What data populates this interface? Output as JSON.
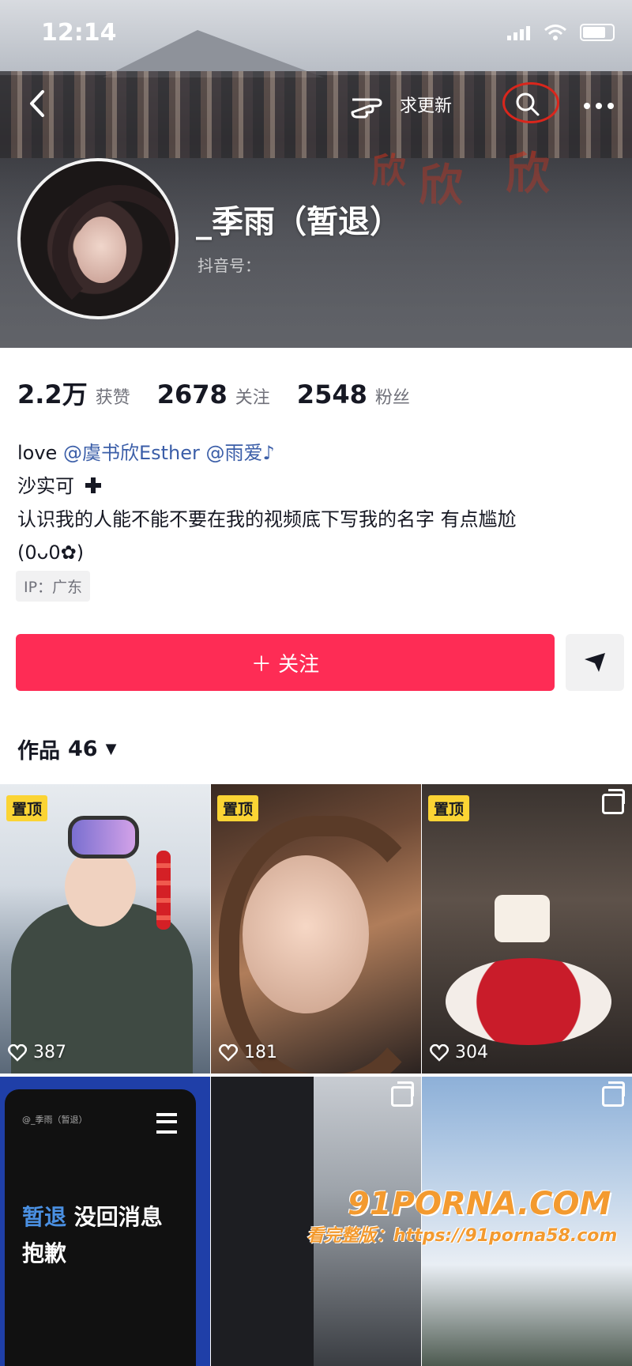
{
  "status_bar": {
    "time": "12:14"
  },
  "header": {
    "back_icon": "chevron-left-icon",
    "request_update_label": "求更新",
    "search_icon": "search-icon",
    "more_icon": "more-icon"
  },
  "banner_text": "欣",
  "profile": {
    "nickname": "_季雨（暂退）",
    "douyin_id_label": "抖音号："
  },
  "stats": [
    {
      "value": "2.2万",
      "label": "获赞"
    },
    {
      "value": "2678",
      "label": "关注"
    },
    {
      "value": "2548",
      "label": "粉丝"
    }
  ],
  "bio": {
    "line1_prefix": "love",
    "mention1": "@虞书欣Esther",
    "mention2": "@雨爱♪",
    "line2": "沙实可",
    "line2_icon": "plus-icon",
    "line3": "认识我的人能不能不要在我的视频底下写我的名字 有点尴尬",
    "line4": "(0ᴗ0✿)"
  },
  "ip_tag": "IP：广东",
  "actions": {
    "follow_label": "＋ 关注",
    "share_icon": "paper-plane-icon"
  },
  "works": {
    "label": "作品",
    "count": "46"
  },
  "tiles": [
    {
      "pinned": "置顶",
      "likes": "387"
    },
    {
      "pinned": "置顶",
      "likes": "181"
    },
    {
      "pinned": "置顶",
      "likes": "304"
    },
    {
      "screen_header": "@_季雨（暂退）",
      "line1_highlight": "暂退",
      "line1_rest": " 没回消息",
      "line2": "抱歉"
    },
    {},
    {}
  ],
  "watermark": {
    "brand": "91PORNA.COM",
    "line": "看完整版：https://91porna58.com"
  },
  "colors": {
    "accent": "#fe2c55",
    "pin": "#fbd434",
    "mention": "#3b5ea8"
  }
}
